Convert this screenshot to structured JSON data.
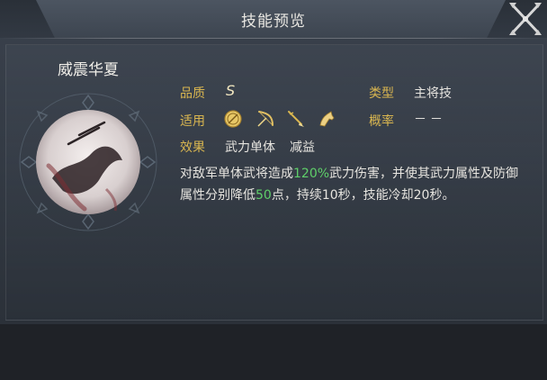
{
  "header": {
    "title": "技能预览"
  },
  "skill": {
    "name": "威震华夏",
    "quality_label": "品质",
    "quality_value": "S",
    "type_label": "类型",
    "type_value": "主将技",
    "applies_label": "适用",
    "applies_icons": [
      "shield-icon",
      "bow-icon",
      "spear-icon",
      "horse-icon"
    ],
    "chance_label": "概率",
    "chance_value": "－－",
    "effect_label": "效果",
    "effect_tags": [
      "武力单体",
      "减益"
    ],
    "description": {
      "p1": "对敌军单体武将造成",
      "damage_pct": "120%",
      "p2": "武力伤害，并使其武力属性及防御属性分别降低",
      "reduce_amount": "50",
      "p3": "点，持续10秒，技能冷却20秒。"
    }
  },
  "colors": {
    "label_gold": "#d9b650",
    "highlight_green": "#5fcf6a",
    "text_light": "#e6e4df"
  }
}
